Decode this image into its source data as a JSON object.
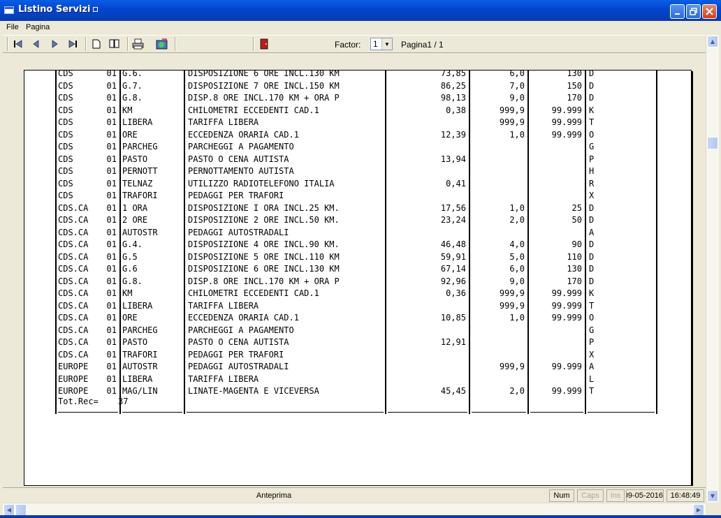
{
  "window": {
    "title": "Listino Servizi"
  },
  "menu": [
    "File",
    "Pagina"
  ],
  "toolbar": {
    "factor_label": "Factor:",
    "factor_value": "1",
    "page_label": "Pagina1 / 1"
  },
  "report": {
    "rows": [
      [
        "CDS",
        "01",
        "G.6.",
        "DISPOSIZIONE 6 ORE INCL.130 KM",
        "73,85",
        "6,0",
        "130",
        "D"
      ],
      [
        "CDS",
        "01",
        "G.7.",
        "DISPOSIZIONE 7 ORE INCL.150 KM",
        "86,25",
        "7,0",
        "150",
        "D"
      ],
      [
        "CDS",
        "01",
        "G.8.",
        "DISP.8 ORE INCL.170 KM + ORA P",
        "98,13",
        "9,0",
        "170",
        "D"
      ],
      [
        "CDS",
        "01",
        "KM",
        "CHILOMETRI ECCEDENTI CAD.1",
        "0,38",
        "999,9",
        "99.999",
        "K"
      ],
      [
        "CDS",
        "01",
        "LIBERA",
        "TARIFFA LIBERA",
        "",
        "999,9",
        "99.999",
        "T"
      ],
      [
        "CDS",
        "01",
        "ORE",
        "ECCEDENZA ORARIA CAD.1",
        "12,39",
        "1,0",
        "99.999",
        "O"
      ],
      [
        "CDS",
        "01",
        "PARCHEG",
        "PARCHEGGI A PAGAMENTO",
        "",
        "",
        "",
        "G"
      ],
      [
        "CDS",
        "01",
        "PASTO",
        "PASTO O CENA AUTISTA",
        "13,94",
        "",
        "",
        "P"
      ],
      [
        "CDS",
        "01",
        "PERNOTT",
        "PERNOTTAMENTO AUTISTA",
        "",
        "",
        "",
        "H"
      ],
      [
        "CDS",
        "01",
        "TELNAZ",
        "UTILIZZO RADIOTELEFONO ITALIA",
        "0,41",
        "",
        "",
        "R"
      ],
      [
        "CDS",
        "01",
        "TRAFORI",
        "PEDAGGI PER TRAFORI",
        "",
        "",
        "",
        "X"
      ],
      [
        "CDS.CA",
        "01",
        "1 ORA",
        "DISPOSIZIONE I ORA INCL.25 KM.",
        "17,56",
        "1,0",
        "25",
        "D"
      ],
      [
        "CDS.CA",
        "01",
        "2 ORE",
        "DISPOSIZIONE 2 ORE INCL.50 KM.",
        "23,24",
        "2,0",
        "50",
        "D"
      ],
      [
        "CDS.CA",
        "01",
        "AUTOSTR",
        "PEDAGGI AUTOSTRADALI",
        "",
        "",
        "",
        "A"
      ],
      [
        "CDS.CA",
        "01",
        "G.4.",
        "DISPOSIZIONE 4 ORE INCL.90 KM.",
        "46,48",
        "4,0",
        "90",
        "D"
      ],
      [
        "CDS.CA",
        "01",
        "G.5",
        "DISPOSIZIONE 5 ORE INCL.110 KM",
        "59,91",
        "5,0",
        "110",
        "D"
      ],
      [
        "CDS.CA",
        "01",
        "G.6",
        "DISPOSIZIONE 6 ORE INCL.130 KM",
        "67,14",
        "6,0",
        "130",
        "D"
      ],
      [
        "CDS.CA",
        "01",
        "G.8.",
        "DISP.8 ORE INCL.170 KM + ORA P",
        "92,96",
        "9,0",
        "170",
        "D"
      ],
      [
        "CDS.CA",
        "01",
        "KM",
        "CHILOMETRI ECCEDENTI CAD.1",
        "0,36",
        "999,9",
        "99.999",
        "K"
      ],
      [
        "CDS.CA",
        "01",
        "LIBERA",
        "TARIFFA LIBERA",
        "",
        "999,9",
        "99.999",
        "T"
      ],
      [
        "CDS.CA",
        "01",
        "ORE",
        "ECCEDENZA ORARIA CAD.1",
        "10,85",
        "1,0",
        "99.999",
        "O"
      ],
      [
        "CDS.CA",
        "01",
        "PARCHEG",
        "PARCHEGGI A PAGAMENTO",
        "",
        "",
        "",
        "G"
      ],
      [
        "CDS.CA",
        "01",
        "PASTO",
        "PASTO O CENA AUTISTA",
        "12,91",
        "",
        "",
        "P"
      ],
      [
        "CDS.CA",
        "01",
        "TRAFORI",
        "PEDAGGI PER TRAFORI",
        "",
        "",
        "",
        "X"
      ],
      [
        "EUROPE",
        "01",
        "AUTOSTR",
        "PEDAGGI AUTOSTRADALI",
        "",
        "999,9",
        "99.999",
        "A"
      ],
      [
        "EUROPE",
        "01",
        "LIBERA",
        "TARIFFA LIBERA",
        "",
        "",
        "",
        "L"
      ],
      [
        "EUROPE",
        "01",
        "MAG/LIN",
        "LINATE-MAGENTA E VICEVERSA",
        "45,45",
        "2,0",
        "99.999",
        "T"
      ]
    ],
    "total_label": "Tot.Rec=",
    "total_value": "37"
  },
  "status": {
    "mode": "Anteprima",
    "num": "Num",
    "caps": "Caps",
    "ins": "Ins",
    "date": "09-05-2016",
    "time": "16:48:49"
  }
}
